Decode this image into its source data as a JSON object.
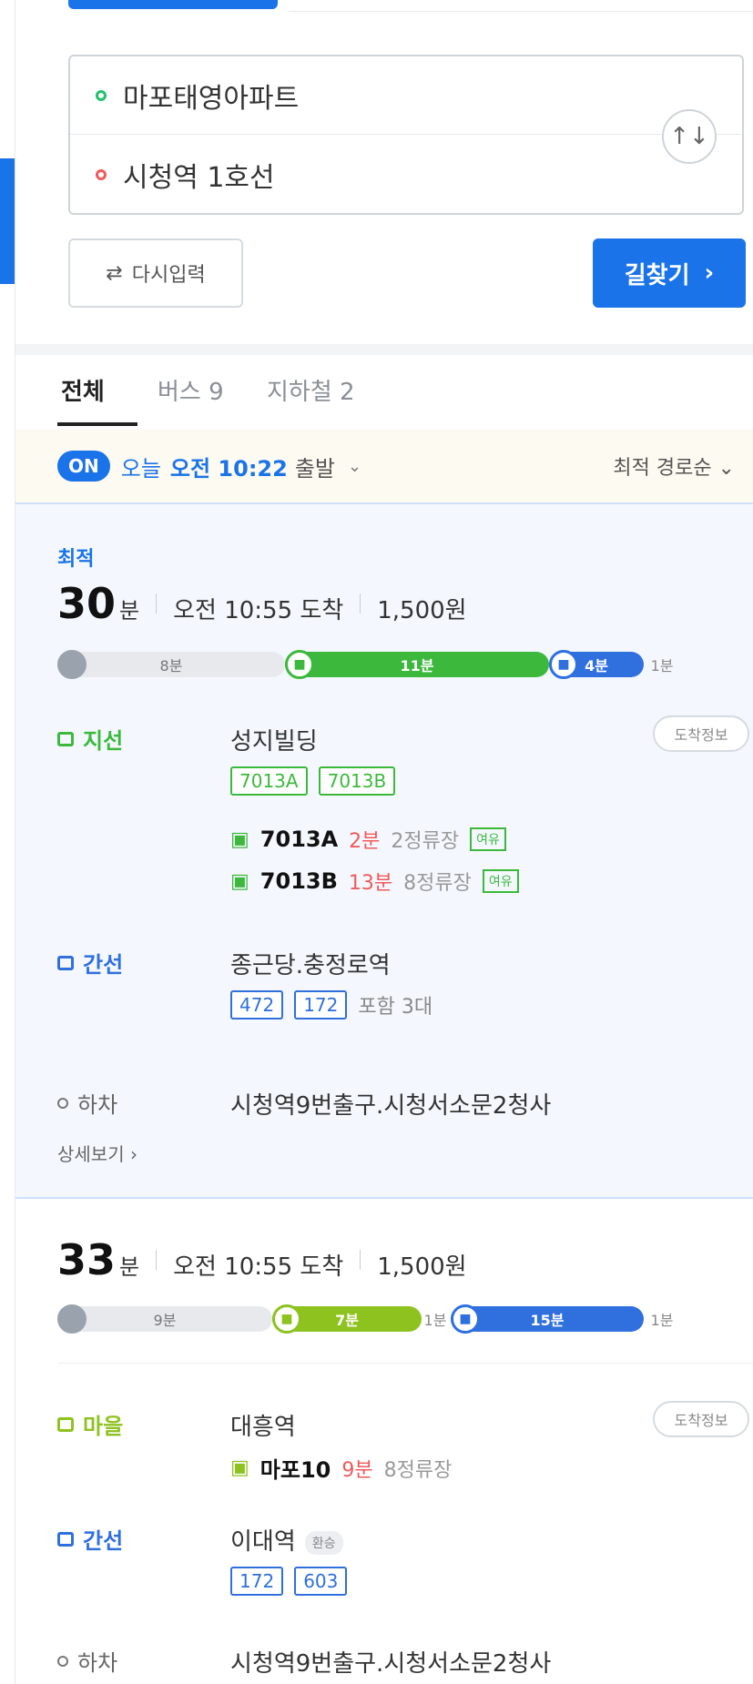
{
  "route": {
    "start": "마포태영아파트",
    "end": "시청역 1호선",
    "swap_icon": "↑↓",
    "reset_label": "다시입력",
    "reset_icon": "⇄",
    "search_label": "길찾기",
    "search_chevron": "›"
  },
  "tabs": [
    {
      "label": "전체"
    },
    {
      "label": "버스 9"
    },
    {
      "label": "지하철 2"
    }
  ],
  "departure": {
    "on": "ON",
    "prefix": "오늘",
    "time": "오전 10:22",
    "suffix": "출발",
    "chevron": "⌄",
    "sort": "최적 경로순 ⌄"
  },
  "results": [
    {
      "badge": "최적",
      "minutes": "30",
      "minute_unit": "분",
      "arrival": "오전 10:55 도착",
      "fare": "1,500원",
      "bar": {
        "walk1": "8분",
        "ride1": "11분",
        "ride2": "4분",
        "walk2": "1분",
        "ride1_color": "#3cb93c",
        "ride2_color": "#2f6fde"
      },
      "steps": [
        {
          "type": "지선",
          "station": "성지빌딩",
          "detail": "도착정보",
          "routes": [
            "7013A",
            "7013B"
          ],
          "arrivals": [
            {
              "bus": "7013A",
              "mins": "2분",
              "stops": "2정류장",
              "tag": "여유"
            },
            {
              "bus": "7013B",
              "mins": "13분",
              "stops": "8정류장",
              "tag": "여유"
            }
          ]
        },
        {
          "type": "간선",
          "station": "종근당.충정로역",
          "routes": [
            "472",
            "172"
          ],
          "routes_note": "포함 3대"
        },
        {
          "type": "하차",
          "station": "시청역9번출구.시청서소문2청사"
        }
      ],
      "more": "상세보기 ›"
    },
    {
      "minutes": "33",
      "minute_unit": "분",
      "arrival": "오전 10:55 도착",
      "fare": "1,500원",
      "bar": {
        "walk1": "9분",
        "ride1": "7분",
        "mid": "1분",
        "ride2": "15분",
        "walk2": "1분",
        "ride1_color": "#8dc21f",
        "ride2_color": "#2f6fde"
      },
      "steps": [
        {
          "type": "마을",
          "station": "대흥역",
          "detail": "도착정보",
          "arrivals": [
            {
              "bus": "마포10",
              "mins": "9분",
              "stops": "8정류장"
            }
          ]
        },
        {
          "type": "간선",
          "station": "이대역",
          "station_tag": "환승",
          "routes": [
            "172",
            "603"
          ]
        },
        {
          "type": "하차",
          "station": "시청역9번출구.시청서소문2청사"
        }
      ]
    }
  ]
}
